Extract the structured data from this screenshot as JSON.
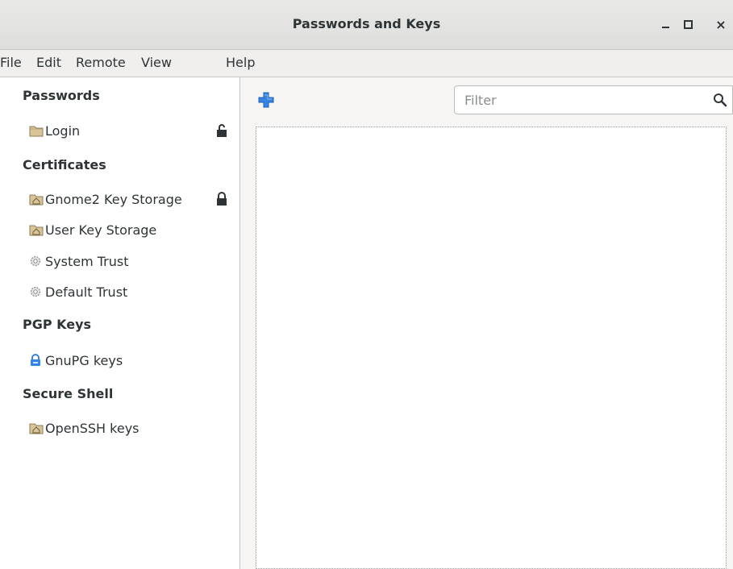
{
  "window": {
    "title": "Passwords and Keys",
    "controls": {
      "minimize_icon": "minimize-icon",
      "maximize_icon": "maximize-icon",
      "close_icon": "close-icon",
      "close_glyph": "×"
    }
  },
  "menubar": {
    "items": [
      "File",
      "Edit",
      "Remote",
      "View",
      "Help"
    ]
  },
  "sidebar": {
    "sections": [
      {
        "heading": "Passwords",
        "items": [
          {
            "label": "Login",
            "icon": "folder-icon",
            "locked": true,
            "lock_state": "unlocked"
          }
        ]
      },
      {
        "heading": "Certificates",
        "items": [
          {
            "label": "Gnome2 Key Storage",
            "icon": "home-folder-icon",
            "locked": true,
            "lock_state": "locked"
          },
          {
            "label": "User Key Storage",
            "icon": "home-folder-icon"
          },
          {
            "label": "System Trust",
            "icon": "gear-icon"
          },
          {
            "label": "Default Trust",
            "icon": "gear-icon"
          }
        ]
      },
      {
        "heading": "PGP Keys",
        "items": [
          {
            "label": "GnuPG keys",
            "icon": "pgp-key-icon"
          }
        ]
      },
      {
        "heading": "Secure Shell",
        "items": [
          {
            "label": "OpenSSH keys",
            "icon": "home-folder-icon"
          }
        ]
      }
    ]
  },
  "main": {
    "add_icon": "add-icon",
    "filter": {
      "placeholder": "Filter",
      "icon": "search-icon"
    }
  },
  "colors": {
    "accent_blue": "#3584e4",
    "folder_tan": "#d8c59a",
    "text": "#2e3436"
  }
}
